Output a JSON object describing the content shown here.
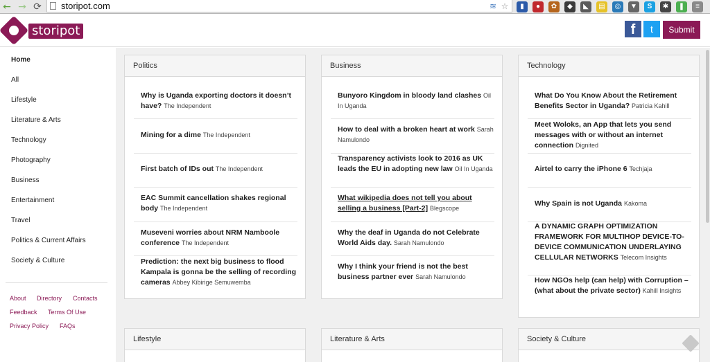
{
  "browser": {
    "url": "storipot.com",
    "back_glyph": "←",
    "forward_glyph": "→",
    "reload_glyph": "⟳",
    "star_glyph": "☆",
    "rss_glyph": "≋",
    "extensions": [
      {
        "name": "chart-extension-icon",
        "color": "#2b5aa8",
        "glyph": "▮"
      },
      {
        "name": "lastpass-extension-icon",
        "color": "#c0282d",
        "glyph": "●"
      },
      {
        "name": "ladybug-extension-icon",
        "color": "#b5651d",
        "glyph": "✿"
      },
      {
        "name": "shield-extension-icon",
        "color": "#3a3a3a",
        "glyph": "◆"
      },
      {
        "name": "tag-extension-icon",
        "color": "#5a5a5a",
        "glyph": "◣"
      },
      {
        "name": "note-extension-icon",
        "color": "#e6c229",
        "glyph": "▤"
      },
      {
        "name": "globe-extension-icon",
        "color": "#2a7ab8",
        "glyph": "◎"
      },
      {
        "name": "pocket-extension-icon",
        "color": "#666666",
        "glyph": "▼"
      },
      {
        "name": "skype-extension-icon",
        "color": "#1ba1e2",
        "glyph": "S"
      },
      {
        "name": "gear-extension-icon",
        "color": "#444444",
        "glyph": "✱"
      },
      {
        "name": "evernote-extension-icon",
        "color": "#4caf50",
        "glyph": "❚"
      },
      {
        "name": "menu-extension-icon",
        "color": "#8a8a8a",
        "glyph": "≡"
      }
    ]
  },
  "header": {
    "logo_text": "storipot",
    "facebook_glyph": "f",
    "twitter_glyph": "t",
    "submit_label": "Submit"
  },
  "sidebar": {
    "items": [
      {
        "label": "Home",
        "active": true
      },
      {
        "label": "All"
      },
      {
        "label": "Lifestyle"
      },
      {
        "label": "Literature & Arts"
      },
      {
        "label": "Technology"
      },
      {
        "label": "Photography"
      },
      {
        "label": "Business"
      },
      {
        "label": "Entertainment"
      },
      {
        "label": "Travel"
      },
      {
        "label": "Politics & Current Affairs"
      },
      {
        "label": "Society & Culture"
      }
    ],
    "footer_links": [
      "About",
      "Directory",
      "Contacts",
      "Feedback",
      "Terms Of Use",
      "Privacy Policy",
      "FAQs"
    ]
  },
  "cards": [
    {
      "title": "Politics",
      "items": [
        {
          "title": "Why is Uganda exporting doctors it doesn’t have?",
          "source": "The Independent"
        },
        {
          "title": "Mining for a dime",
          "source": "The Independent"
        },
        {
          "title": "First batch of IDs out",
          "source": "The Independent"
        },
        {
          "title": "EAC Summit cancellation shakes regional body",
          "source": "The Independent"
        },
        {
          "title": "Museveni worries about NRM Namboole conference",
          "source": "The Independent"
        },
        {
          "title": "Prediction: the next big business to flood Kampala is gonna be the selling of recording cameras",
          "source": "Abbey Kibirige Semuwemba"
        }
      ]
    },
    {
      "title": "Business",
      "items": [
        {
          "title": "Bunyoro Kingdom in bloody land clashes",
          "source": "Oil In Uganda"
        },
        {
          "title": "How to deal with a broken heart at work",
          "source": "Sarah Namulondo"
        },
        {
          "title": "Transparency activists look to 2016 as UK leads the EU in adopting new law",
          "source": "Oil In Uganda"
        },
        {
          "title": "What wikipedia does not tell you about selling a business [Part-2]",
          "source": "Blegscope"
        },
        {
          "title": "Why the deaf in Uganda do not Celebrate World Aids day.",
          "source": "Sarah Namulondo"
        },
        {
          "title": "Why I think your friend is not the best business partner ever",
          "source": "Sarah Namulondo"
        }
      ]
    },
    {
      "title": "Technology",
      "items": [
        {
          "title": "What Do You Know About the Retirement Benefits Sector in Uganda?",
          "source": "Patricia Kahill"
        },
        {
          "title": "Meet Woloks, an App that lets you send messages with or without an internet connection",
          "source": "Dignited"
        },
        {
          "title": "Airtel to carry the iPhone 6",
          "source": "Techjaja"
        },
        {
          "title": "Why Spain is not Uganda",
          "source": "Kakoma"
        },
        {
          "title": "A DYNAMIC GRAPH OPTIMIZATION FRAMEWORK FOR MULTIHOP DEVICE-TO-DEVICE COMMUNICATION UNDERLAYING CELLULAR NETWORKS",
          "source": "Telecom Insights"
        },
        {
          "title": "How NGOs help (can help) with Corruption – (what about the private sector)",
          "source": "Kahill Insights"
        }
      ]
    },
    {
      "title": "Lifestyle",
      "items": []
    },
    {
      "title": "Literature & Arts",
      "items": []
    },
    {
      "title": "Society & Culture",
      "items": []
    }
  ]
}
